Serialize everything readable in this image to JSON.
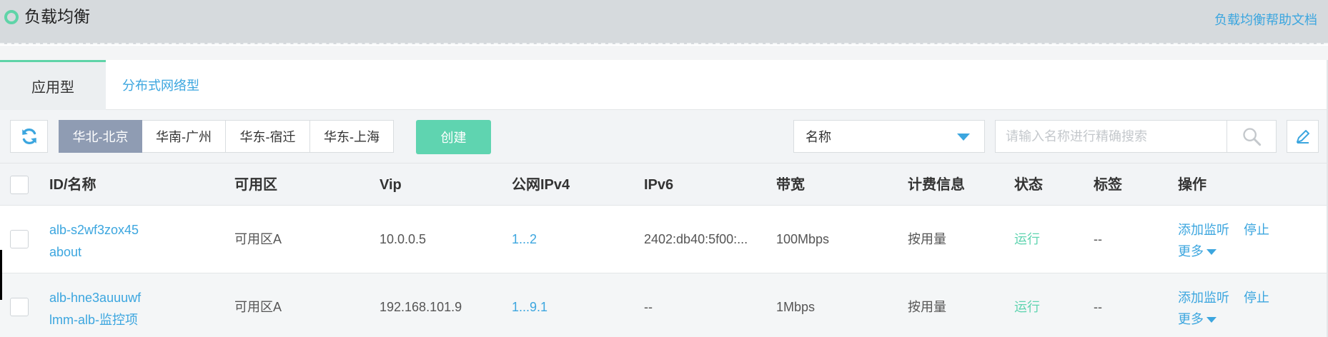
{
  "header": {
    "title": "负载均衡",
    "help_link": "负载均衡帮助文档"
  },
  "tabs": [
    {
      "label": "应用型",
      "active": true
    },
    {
      "label": "分布式网络型",
      "active": false
    }
  ],
  "toolbar": {
    "refresh_icon": "refresh-icon",
    "regions": [
      {
        "label": "华北-北京",
        "active": true
      },
      {
        "label": "华南-广州",
        "active": false
      },
      {
        "label": "华东-宿迁",
        "active": false
      },
      {
        "label": "华东-上海",
        "active": false
      }
    ],
    "create_label": "创建",
    "filter_selected": "名称",
    "search_placeholder": "请输入名称进行精确搜索",
    "search_icon": "search-icon",
    "edit_icon": "edit-icon"
  },
  "table": {
    "columns": [
      "ID/名称",
      "可用区",
      "Vip",
      "公网IPv4",
      "IPv6",
      "带宽",
      "计费信息",
      "状态",
      "标签",
      "操作"
    ],
    "rows": [
      {
        "id": "alb-s2wf3zox45",
        "name": "about",
        "zone": "可用区A",
        "vip": "10.0.0.5",
        "public_ipv4": "1...2",
        "ipv6": "2402:db40:5f00:...",
        "bandwidth": "100Mbps",
        "billing": "按用量",
        "status": "运行",
        "tags": "--",
        "actions": {
          "add_listener": "添加监听",
          "stop": "停止",
          "more": "更多"
        }
      },
      {
        "id": "alb-hne3auuuwf",
        "name": "lmm-alb-监控项",
        "zone": "可用区A",
        "vip": "192.168.101.9",
        "public_ipv4": "1...9.1",
        "ipv6": "--",
        "bandwidth": "1Mbps",
        "billing": "按用量",
        "status": "运行",
        "tags": "--",
        "actions": {
          "add_listener": "添加监听",
          "stop": "停止",
          "more": "更多"
        }
      }
    ]
  },
  "colors": {
    "accent_green": "#5fd4b0",
    "link_blue": "#3ca6df",
    "region_active": "#8f9cb3"
  }
}
